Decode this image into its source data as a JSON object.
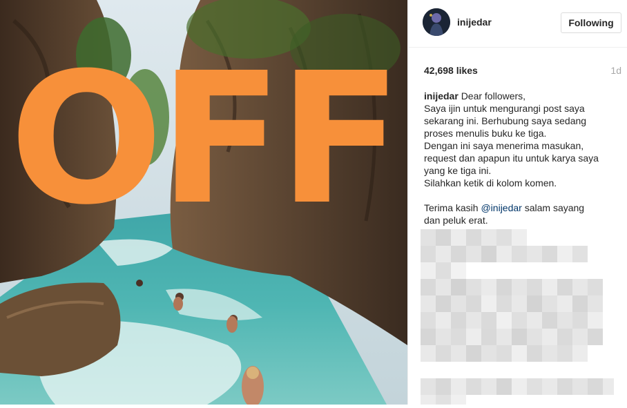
{
  "post": {
    "image_text": "OFF",
    "image_alt": "Surfers paddling through a turquoise river canyon between rocky cliffs"
  },
  "header": {
    "username": "inijedar",
    "follow_label": "Following"
  },
  "stats": {
    "likes": "42,698 likes",
    "time_ago": "1d"
  },
  "caption": {
    "username": "inijedar",
    "lines": [
      "Dear followers,",
      "Saya ijin untuk mengurangi post saya",
      "sekarang ini. Berhubung saya sedang",
      "proses menulis buku ke tiga.",
      "Dengan ini saya menerima masukan,",
      "request dan apapun itu untuk karya saya",
      "yang ke tiga ini.",
      "Silahkan ketik di kolom komen."
    ],
    "closing_prefix": "Terima kasih ",
    "mention": "@inijedar",
    "closing_suffix": " salam sayang",
    "closing_line2": "dan peluk erat."
  },
  "colors": {
    "off_text": "#f7903a",
    "water": "#4fb3b2",
    "mention": "#003569"
  },
  "icons": {
    "comments_area": "pixelated-blur"
  }
}
